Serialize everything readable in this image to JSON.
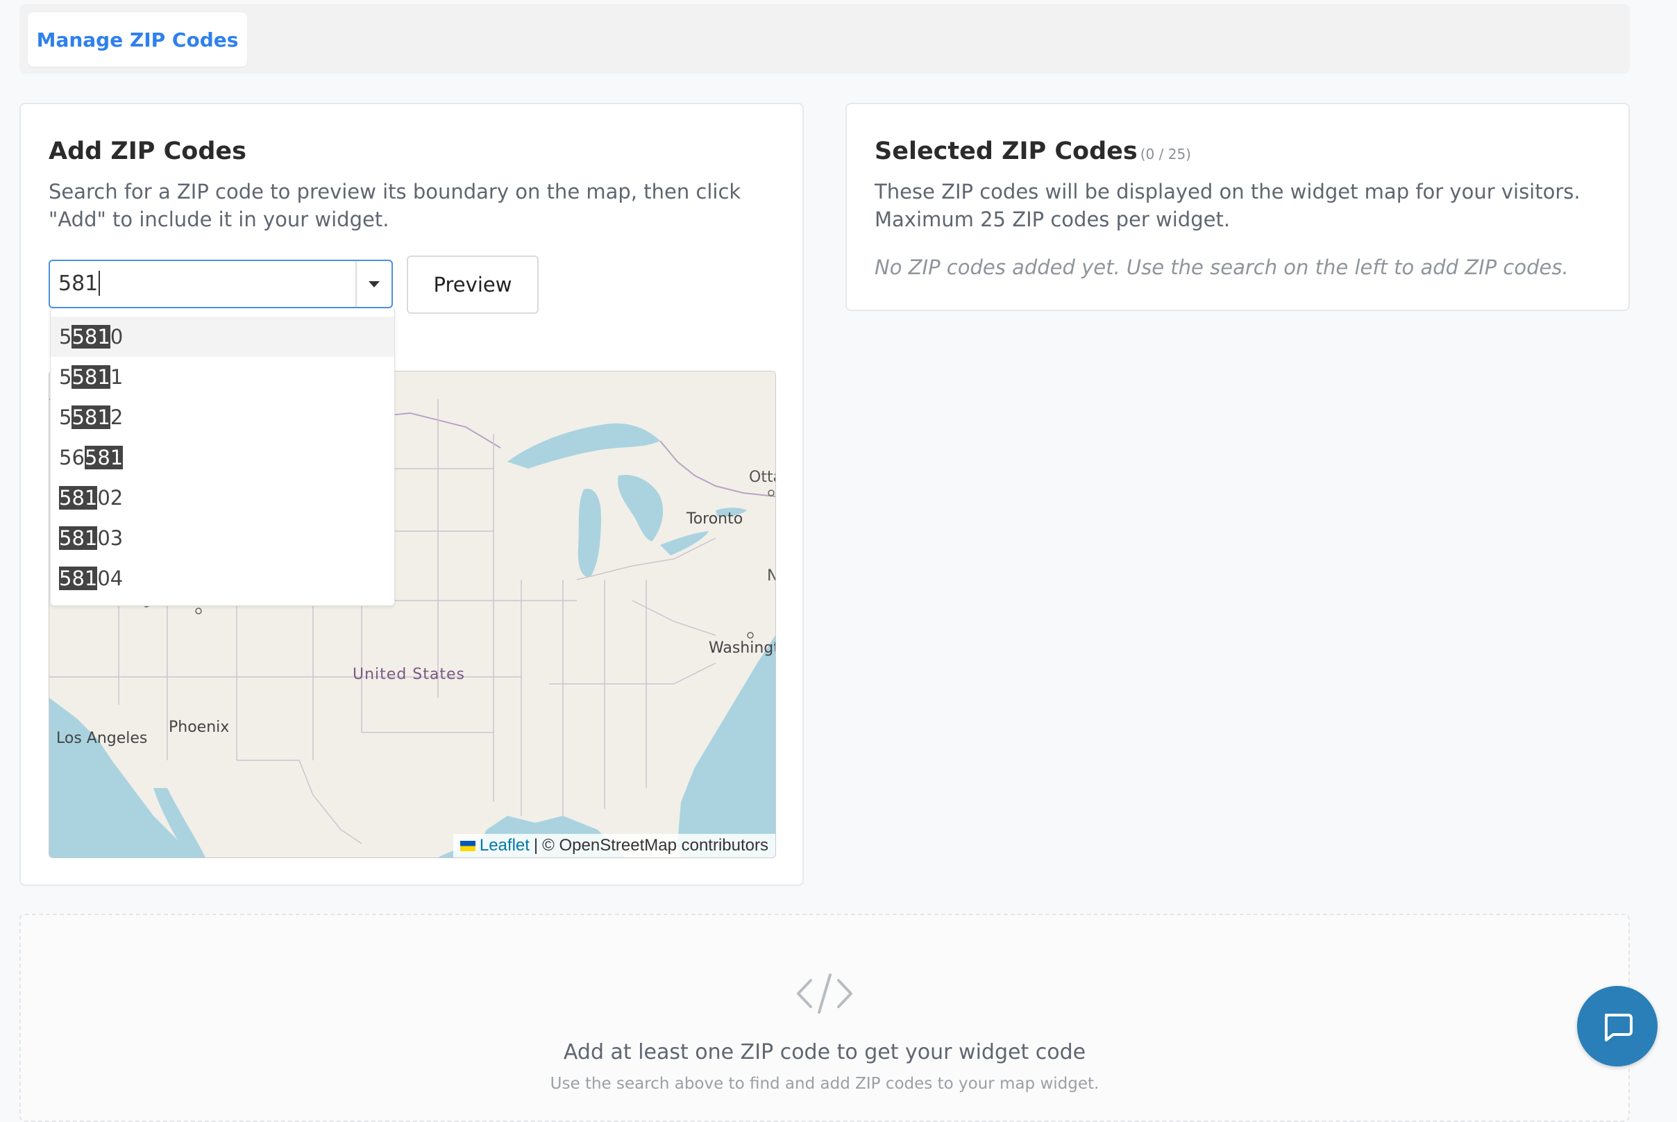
{
  "tabs": {
    "active_label": "Manage ZIP Codes"
  },
  "add_card": {
    "title": "Add ZIP Codes",
    "description": "Search for a ZIP code to preview its boundary on the map, then click \"Add\" to include it in your widget.",
    "search_value": "581",
    "preview_label": "Preview",
    "suggestions": [
      {
        "pre": "5",
        "match": "581",
        "post": "0"
      },
      {
        "pre": "5",
        "match": "581",
        "post": "1"
      },
      {
        "pre": "5",
        "match": "581",
        "post": "2"
      },
      {
        "pre": "56",
        "match": "581",
        "post": ""
      },
      {
        "pre": "",
        "match": "581",
        "post": "02"
      },
      {
        "pre": "",
        "match": "581",
        "post": "03"
      },
      {
        "pre": "",
        "match": "581",
        "post": "04"
      }
    ]
  },
  "map": {
    "labels": {
      "ottawa": "Otta",
      "toronto": "Toronto",
      "new_york": "N",
      "washington": "Washingt",
      "united_states": "United States",
      "phoenix": "Phoenix",
      "los_angeles": "Los Angeles"
    },
    "attribution": {
      "leaflet": "Leaflet",
      "separator": "|",
      "osm": "© OpenStreetMap contributors"
    }
  },
  "selected_card": {
    "title": "Selected ZIP Codes",
    "count": "(0 / 25)",
    "description": "These ZIP codes will be displayed on the widget map for your visitors. Maximum 25 ZIP codes per widget.",
    "empty_message": "No ZIP codes added yet. Use the search on the left to add ZIP codes."
  },
  "widget_code": {
    "title": "Add at least one ZIP code to get your widget code",
    "subtitle": "Use the search above to find and add ZIP codes to your map widget."
  },
  "icons": {
    "code": "code-icon",
    "chat": "chat-icon",
    "caret": "chevron-down-icon"
  },
  "colors": {
    "accent": "#2f80ed",
    "chat_bg": "#2a7fb8",
    "water": "#aad3df",
    "land": "#f2efe9"
  }
}
